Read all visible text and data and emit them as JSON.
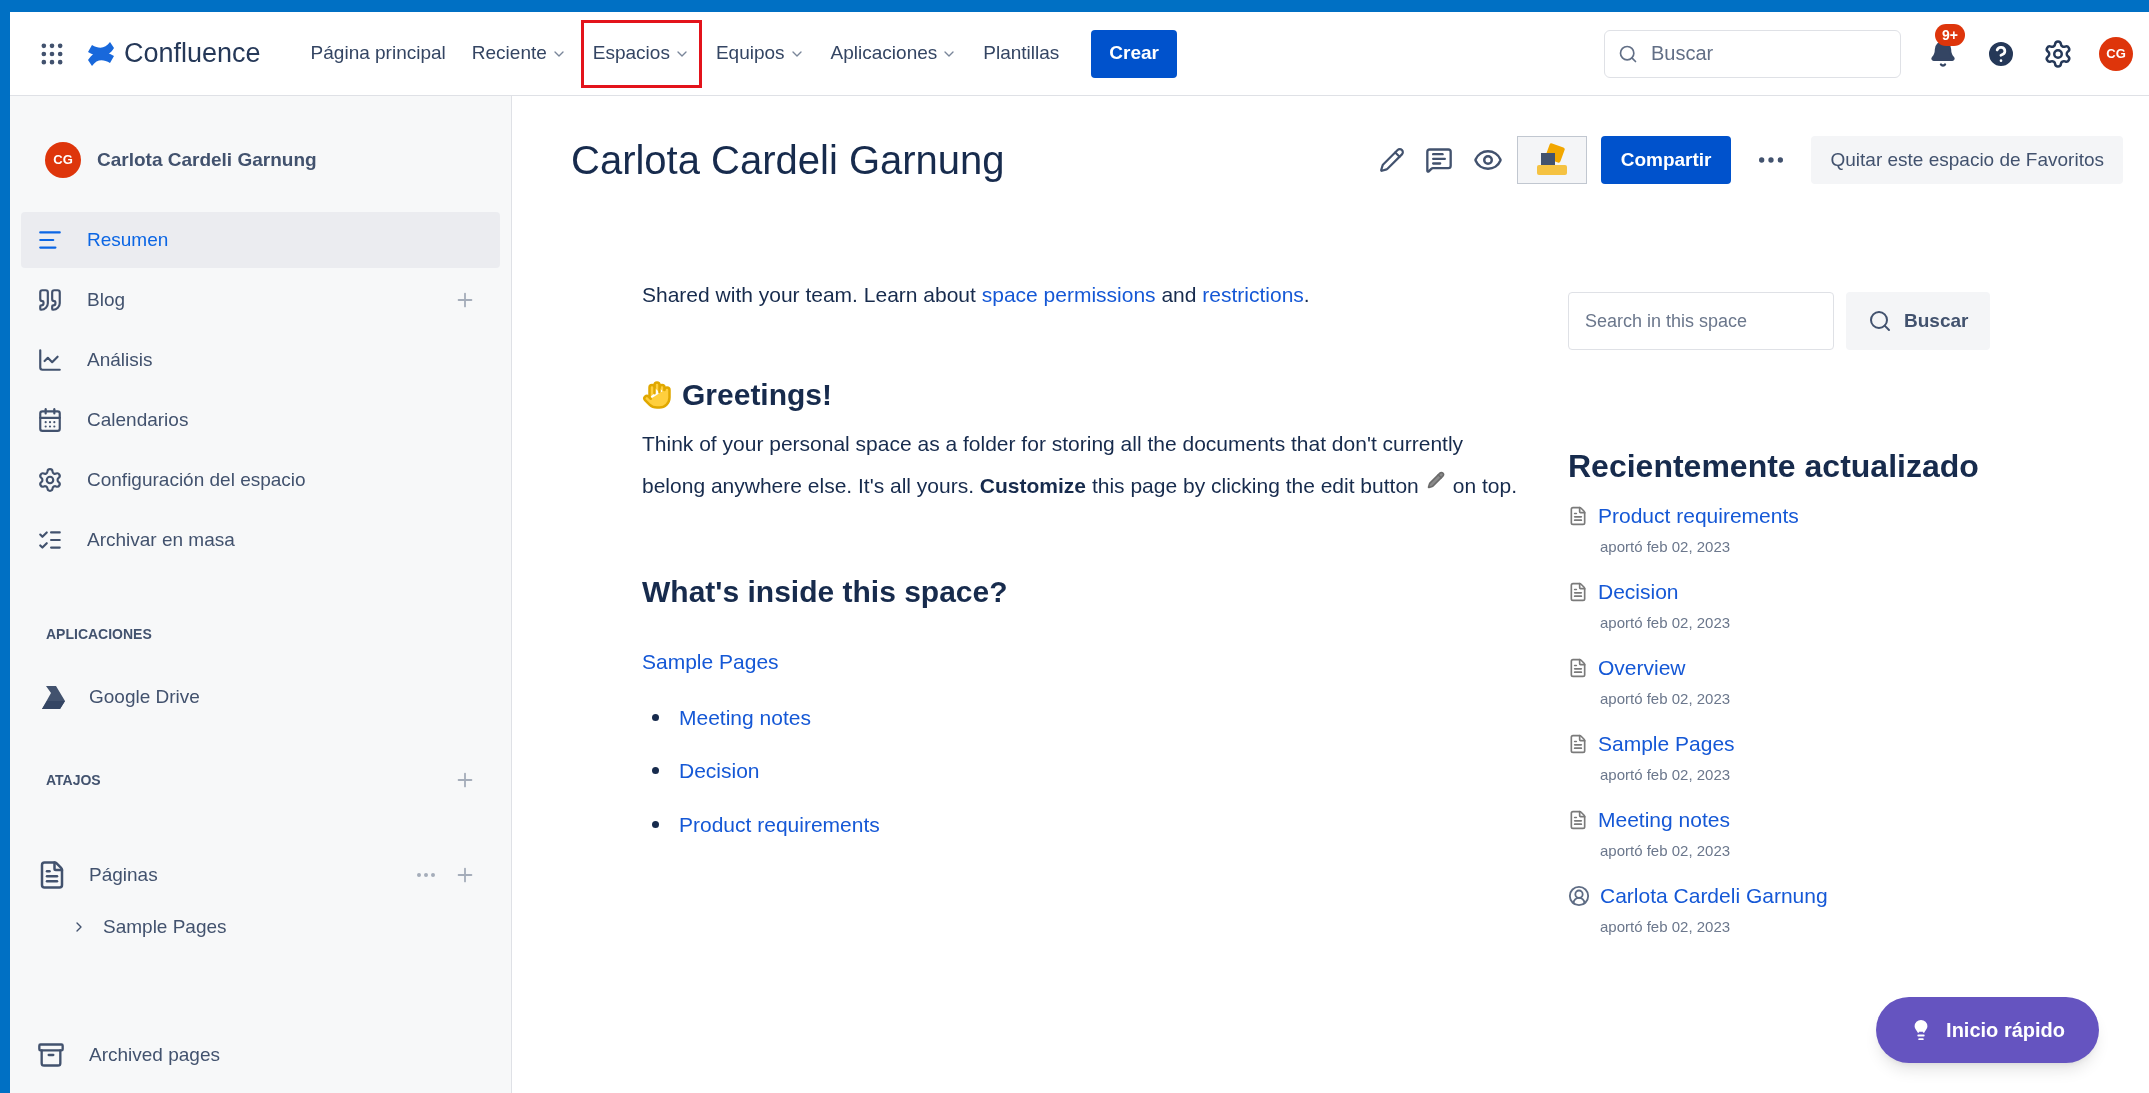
{
  "top_nav": {
    "app_name": "Confluence",
    "items": [
      {
        "label": "Página principal",
        "dropdown": false,
        "highlighted": false
      },
      {
        "label": "Reciente",
        "dropdown": true,
        "highlighted": false
      },
      {
        "label": "Espacios",
        "dropdown": true,
        "highlighted": true
      },
      {
        "label": "Equipos",
        "dropdown": true,
        "highlighted": false
      },
      {
        "label": "Aplicaciones",
        "dropdown": true,
        "highlighted": false
      },
      {
        "label": "Plantillas",
        "dropdown": false,
        "highlighted": false
      }
    ],
    "create_button": "Crear",
    "search": {
      "placeholder": "Buscar"
    },
    "notifications_badge": "9+",
    "avatar_initials": "CG"
  },
  "sidebar": {
    "space_name": "Carlota Cardeli Garnung",
    "avatar_initials": "CG",
    "items": [
      {
        "label": "Resumen",
        "selected": true,
        "add": false
      },
      {
        "label": "Blog",
        "selected": false,
        "add": true
      },
      {
        "label": "Análisis",
        "selected": false,
        "add": false
      },
      {
        "label": "Calendarios",
        "selected": false,
        "add": false
      },
      {
        "label": "Configuración del espacio",
        "selected": false,
        "add": false
      },
      {
        "label": "Archivar en masa",
        "selected": false,
        "add": false
      }
    ],
    "apps_heading": "APLICACIONES",
    "apps": [
      {
        "label": "Google Drive"
      }
    ],
    "shortcuts_heading": "ATAJOS",
    "pages": {
      "label": "Páginas",
      "children": [
        {
          "label": "Sample Pages",
          "expanded": false
        }
      ]
    },
    "archived": "Archived pages"
  },
  "page": {
    "title": "Carlota Cardeli Garnung",
    "share_button": "Compartir",
    "favorite_button": "Quitar este espacio de Favoritos",
    "intro": [
      {
        "text": "Shared with your team. Learn about ",
        "link": false
      },
      {
        "text": "space permissions",
        "link": true
      },
      {
        "text": " and ",
        "link": false
      },
      {
        "text": "restrictions",
        "link": true
      },
      {
        "text": ".",
        "link": false
      }
    ],
    "greeting_heading": "Greetings!",
    "greeting_text": "Think of your personal space as a folder for storing all the documents that don't currently belong anywhere else. It's all yours. **Customize** this page by clicking the edit button",
    "greeting_text_end": "on top.",
    "inside_heading": "What's inside this space?",
    "sample_link": "Sample Pages",
    "links": [
      "Meeting notes",
      "Decision",
      "Product requirements"
    ]
  },
  "side_panel": {
    "search": {
      "placeholder": "Search in this space"
    },
    "search_button": "Buscar",
    "recent_heading": "Recientemente actualizado",
    "recent": [
      {
        "title": "Product requirements",
        "kind": "page",
        "meta": "aportó feb 02, 2023"
      },
      {
        "title": "Decision",
        "kind": "page",
        "meta": "aportó feb 02, 2023"
      },
      {
        "title": "Overview",
        "kind": "page",
        "meta": "aportó feb 02, 2023"
      },
      {
        "title": "Sample Pages",
        "kind": "page",
        "meta": "aportó feb 02, 2023"
      },
      {
        "title": "Meeting notes",
        "kind": "page",
        "meta": "aportó feb 02, 2023"
      },
      {
        "title": "Carlota Cardeli Garnung",
        "kind": "person",
        "meta": "aportó feb 02, 2023"
      }
    ]
  },
  "quick_start_button": "Inicio rápido"
}
